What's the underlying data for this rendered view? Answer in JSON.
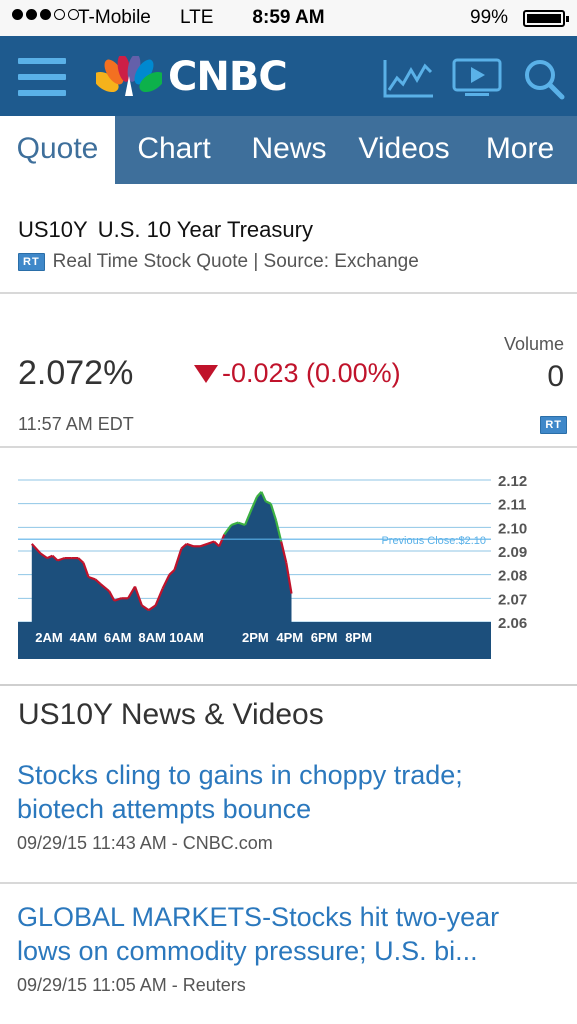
{
  "status_bar": {
    "carrier": "T-Mobile",
    "network": "LTE",
    "time": "8:59 AM",
    "battery": "99%"
  },
  "header": {
    "logo_text": "CNBC",
    "brand_color": "#1e5a8e",
    "icons": [
      "menu-icon",
      "peacock-logo",
      "chart-icon",
      "tv-icon",
      "search-icon"
    ]
  },
  "tabs": [
    {
      "label": "Quote",
      "active": true
    },
    {
      "label": "Chart"
    },
    {
      "label": "News"
    },
    {
      "label": "Videos"
    },
    {
      "label": "More"
    }
  ],
  "quote": {
    "symbol": "US10Y",
    "name": "U.S. 10 Year Treasury",
    "rt_badge": "RT",
    "source_line": "Real Time Stock Quote | Source: Exchange",
    "price": "2.072%",
    "change": "-0.023 (0.00%)",
    "change_color": "#c0132b",
    "volume_label": "Volume",
    "volume_value": "0",
    "time": "11:57 AM EDT"
  },
  "chart_data": {
    "type": "area",
    "title": "",
    "xlabel": "",
    "ylabel": "",
    "x_ticks": [
      "2AM",
      "4AM",
      "6AM",
      "8AM",
      "10AM",
      "2PM",
      "4PM",
      "6PM",
      "8PM"
    ],
    "y_ticks": [
      "2.12",
      "2.11",
      "2.10",
      "2.09",
      "2.08",
      "2.07",
      "2.06"
    ],
    "ylim": [
      2.06,
      2.12
    ],
    "reference_line": {
      "label": "Previous Close:$2.10",
      "value": 2.095
    },
    "series": [
      {
        "values": [
          [
            1.0,
            2.093
          ],
          [
            1.5,
            2.089
          ],
          [
            1.9,
            2.087
          ],
          [
            2.2,
            2.088
          ],
          [
            2.5,
            2.086
          ],
          [
            2.9,
            2.087
          ],
          [
            3.3,
            2.087
          ],
          [
            3.7,
            2.087
          ],
          [
            4.0,
            2.085
          ],
          [
            4.3,
            2.079
          ],
          [
            4.7,
            2.078
          ],
          [
            5.0,
            2.076
          ],
          [
            5.5,
            2.073
          ],
          [
            5.8,
            2.069
          ],
          [
            6.2,
            2.07
          ],
          [
            6.6,
            2.07
          ],
          [
            7.0,
            2.075
          ],
          [
            7.4,
            2.067
          ],
          [
            7.8,
            2.065
          ],
          [
            8.2,
            2.067
          ],
          [
            8.6,
            2.074
          ],
          [
            9.0,
            2.08
          ],
          [
            9.3,
            2.082
          ],
          [
            9.7,
            2.091
          ],
          [
            10.0,
            2.093
          ],
          [
            10.4,
            2.092
          ],
          [
            10.8,
            2.092
          ],
          [
            11.2,
            2.093
          ],
          [
            11.6,
            2.094
          ],
          [
            11.9,
            2.092
          ],
          [
            12.2,
            2.097
          ],
          [
            12.6,
            2.101
          ],
          [
            13.0,
            2.102
          ],
          [
            13.4,
            2.101
          ],
          [
            13.8,
            2.108
          ],
          [
            14.1,
            2.113
          ],
          [
            14.35,
            2.115
          ],
          [
            14.6,
            2.111
          ],
          [
            14.9,
            2.11
          ],
          [
            15.2,
            2.103
          ],
          [
            15.5,
            2.094
          ],
          [
            15.8,
            2.085
          ],
          [
            16.1,
            2.072
          ]
        ]
      }
    ],
    "grid": true,
    "fill_color": "#1c4f7c",
    "line_color": "#c0132b"
  },
  "news": {
    "heading": "US10Y News & Videos",
    "items": [
      {
        "headline_line1": "Stocks cling to gains in choppy trade;",
        "headline_line2": "biotech attempts bounce",
        "meta": "09/29/15 11:43 AM - CNBC.com"
      },
      {
        "headline_line1": "GLOBAL MARKETS-Stocks hit two-year",
        "headline_line2": "lows on commodity pressure; U.S. bi...",
        "meta": "09/29/15 11:05 AM - Reuters"
      }
    ]
  }
}
